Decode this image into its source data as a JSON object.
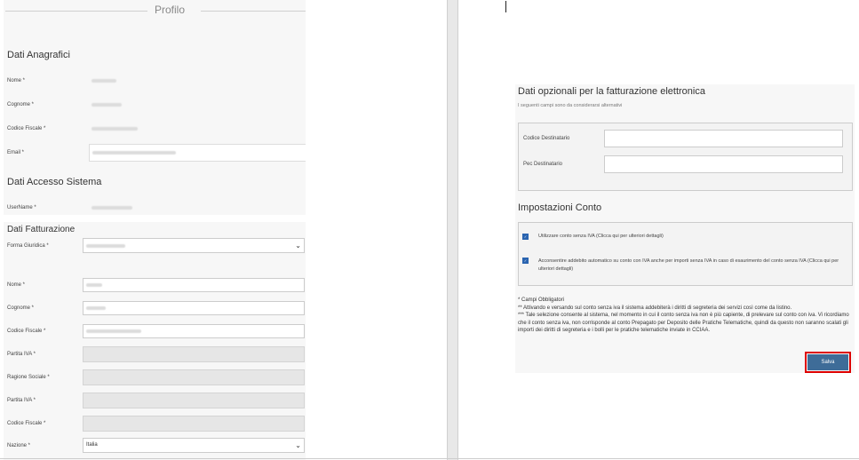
{
  "profile": {
    "title": "Profilo",
    "anagrafici": {
      "heading": "Dati Anagrafici",
      "nome_label": "Nome *",
      "cognome_label": "Cognome *",
      "cf_label": "Codice Fiscale *",
      "email_label": "Email *"
    },
    "accesso": {
      "heading": "Dati Accesso Sistema",
      "username_label": "UserName *"
    },
    "fatturazione": {
      "heading": "Dati Fatturazione",
      "forma_label": "Forma Giuridica *",
      "nome_label": "Nome *",
      "cognome_label": "Cognome *",
      "cf_label": "Codice Fiscale *",
      "piva_label": "Partita IVA *",
      "ragione_label": "Ragione Sociale *",
      "piva2_label": "Partita IVA *",
      "cf2_label": "Codice Fiscale *",
      "nazione_label": "Nazione *",
      "nazione_value": "Italia"
    }
  },
  "right": {
    "efatt": {
      "heading": "Dati opzionali per la fatturazione elettronica",
      "subtitle": "I seguenti campi sono da considerarsi alternativi",
      "codice_label": "Codice Destinatario",
      "pec_label": "Pec Destinatario"
    },
    "conto": {
      "heading": "Impostazioni Conto",
      "opt1": "Utilizzare conto senza IVA (Clicca qui per ulteriori dettagli)",
      "opt2": "Acconsentire addebito automatico su conto con IVA anche per importi senza IVA in caso di esaurimento del conto senza IVA (Clicca qui per ulteriori dettagli)"
    },
    "notes": {
      "n1": "* Campi Obbligatori",
      "n2": "** Attivando e versando sul conto senza iva il sistema addebiterà i diritti di segreteria dei servizi così come da listino.",
      "n3": "*** Tale selezione consente al sistema, nel momento in cui il conto senza iva non è più capiente, di prelevare sul conto con iva. Vi ricordiamo che il conto senza iva, non corrisponde al conto Prepagato per Deposito delle Pratiche Telematiche, quindi da questo non saranno scalati gli importi dei diritti di segreteria e i bolli per le pratiche telematiche inviate in CCIAA."
    },
    "save_label": "Salva"
  }
}
